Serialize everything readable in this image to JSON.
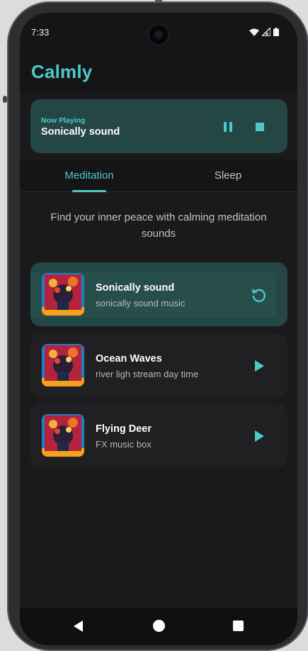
{
  "status_bar": {
    "time": "7:33",
    "icons": [
      "wifi-icon",
      "signal-icon",
      "battery-icon"
    ]
  },
  "app": {
    "title": "Calmly"
  },
  "now_playing": {
    "label": "Now Playing",
    "title": "Sonically sound",
    "controls": [
      "pause-icon",
      "stop-icon"
    ]
  },
  "tabs": [
    {
      "label": "Meditation",
      "selected": true
    },
    {
      "label": "Sleep",
      "selected": false
    }
  ],
  "intro_text": "Find your inner peace with calming meditation sounds",
  "tracks": [
    {
      "title": "Sonically sound",
      "subtitle": "sonically sound music",
      "action_icon": "replay-icon",
      "active": true
    },
    {
      "title": "Ocean Waves",
      "subtitle": "river ligh stream day time",
      "action_icon": "play-icon",
      "active": false
    },
    {
      "title": "Flying Deer",
      "subtitle": "FX music box",
      "action_icon": "play-icon",
      "active": false
    }
  ],
  "nav": {
    "buttons": [
      "back-icon",
      "home-icon",
      "recents-icon"
    ]
  },
  "colors": {
    "accent": "#4ec9c8",
    "background": "#151517",
    "card": "#202022",
    "active_card": "#244644"
  }
}
